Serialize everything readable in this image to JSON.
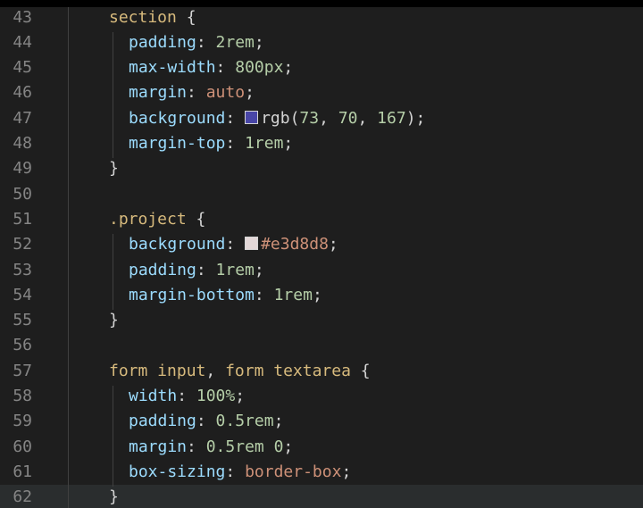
{
  "colors": {
    "swatch_purple": "#4946a7",
    "swatch_light": "#e3d8d8"
  },
  "lines": [
    {
      "n": "43",
      "tokens": [
        [
          "sel",
          "section"
        ],
        [
          "punc",
          " {"
        ]
      ]
    },
    {
      "n": "44",
      "tokens": [
        [
          "prop",
          "padding"
        ],
        [
          "punc",
          ": "
        ],
        [
          "num",
          "2rem"
        ],
        [
          "punc",
          ";"
        ]
      ]
    },
    {
      "n": "45",
      "tokens": [
        [
          "prop",
          "max-width"
        ],
        [
          "punc",
          ": "
        ],
        [
          "num",
          "800px"
        ],
        [
          "punc",
          ";"
        ]
      ]
    },
    {
      "n": "46",
      "tokens": [
        [
          "prop",
          "margin"
        ],
        [
          "punc",
          ": "
        ],
        [
          "val",
          "auto"
        ],
        [
          "punc",
          ";"
        ]
      ]
    },
    {
      "n": "47",
      "tokens": [
        [
          "prop",
          "background"
        ],
        [
          "punc",
          ": "
        ],
        [
          "swatch",
          "swatch_purple"
        ],
        [
          "punc",
          "rgb("
        ],
        [
          "num",
          "73"
        ],
        [
          "punc",
          ", "
        ],
        [
          "num",
          "70"
        ],
        [
          "punc",
          ", "
        ],
        [
          "num",
          "167"
        ],
        [
          "punc",
          ");"
        ]
      ]
    },
    {
      "n": "48",
      "tokens": [
        [
          "prop",
          "margin-top"
        ],
        [
          "punc",
          ": "
        ],
        [
          "num",
          "1rem"
        ],
        [
          "punc",
          ";"
        ]
      ]
    },
    {
      "n": "49",
      "tokens": [
        [
          "brace",
          "}"
        ]
      ]
    },
    {
      "n": "50",
      "tokens": []
    },
    {
      "n": "51",
      "tokens": [
        [
          "sel",
          ".project"
        ],
        [
          "punc",
          " {"
        ]
      ]
    },
    {
      "n": "52",
      "tokens": [
        [
          "prop",
          "background"
        ],
        [
          "punc",
          ": "
        ],
        [
          "swatch",
          "swatch_light"
        ],
        [
          "val",
          "#e3d8d8"
        ],
        [
          "punc",
          ";"
        ]
      ]
    },
    {
      "n": "53",
      "tokens": [
        [
          "prop",
          "padding"
        ],
        [
          "punc",
          ": "
        ],
        [
          "num",
          "1rem"
        ],
        [
          "punc",
          ";"
        ]
      ]
    },
    {
      "n": "54",
      "tokens": [
        [
          "prop",
          "margin-bottom"
        ],
        [
          "punc",
          ": "
        ],
        [
          "num",
          "1rem"
        ],
        [
          "punc",
          ";"
        ]
      ]
    },
    {
      "n": "55",
      "tokens": [
        [
          "brace",
          "}"
        ]
      ]
    },
    {
      "n": "56",
      "tokens": []
    },
    {
      "n": "57",
      "tokens": [
        [
          "sel",
          "form input"
        ],
        [
          "punc",
          ", "
        ],
        [
          "sel",
          "form textarea"
        ],
        [
          "punc",
          " {"
        ]
      ]
    },
    {
      "n": "58",
      "tokens": [
        [
          "prop",
          "width"
        ],
        [
          "punc",
          ": "
        ],
        [
          "num",
          "100%"
        ],
        [
          "punc",
          ";"
        ]
      ]
    },
    {
      "n": "59",
      "tokens": [
        [
          "prop",
          "padding"
        ],
        [
          "punc",
          ": "
        ],
        [
          "num",
          "0.5rem"
        ],
        [
          "punc",
          ";"
        ]
      ]
    },
    {
      "n": "60",
      "tokens": [
        [
          "prop",
          "margin"
        ],
        [
          "punc",
          ": "
        ],
        [
          "num",
          "0.5rem 0"
        ],
        [
          "punc",
          ";"
        ]
      ]
    },
    {
      "n": "61",
      "tokens": [
        [
          "prop",
          "box-sizing"
        ],
        [
          "punc",
          ": "
        ],
        [
          "val",
          "border-box"
        ],
        [
          "punc",
          ";"
        ]
      ]
    },
    {
      "n": "62",
      "tokens": [
        [
          "brace",
          "}"
        ]
      ],
      "current": true
    }
  ]
}
